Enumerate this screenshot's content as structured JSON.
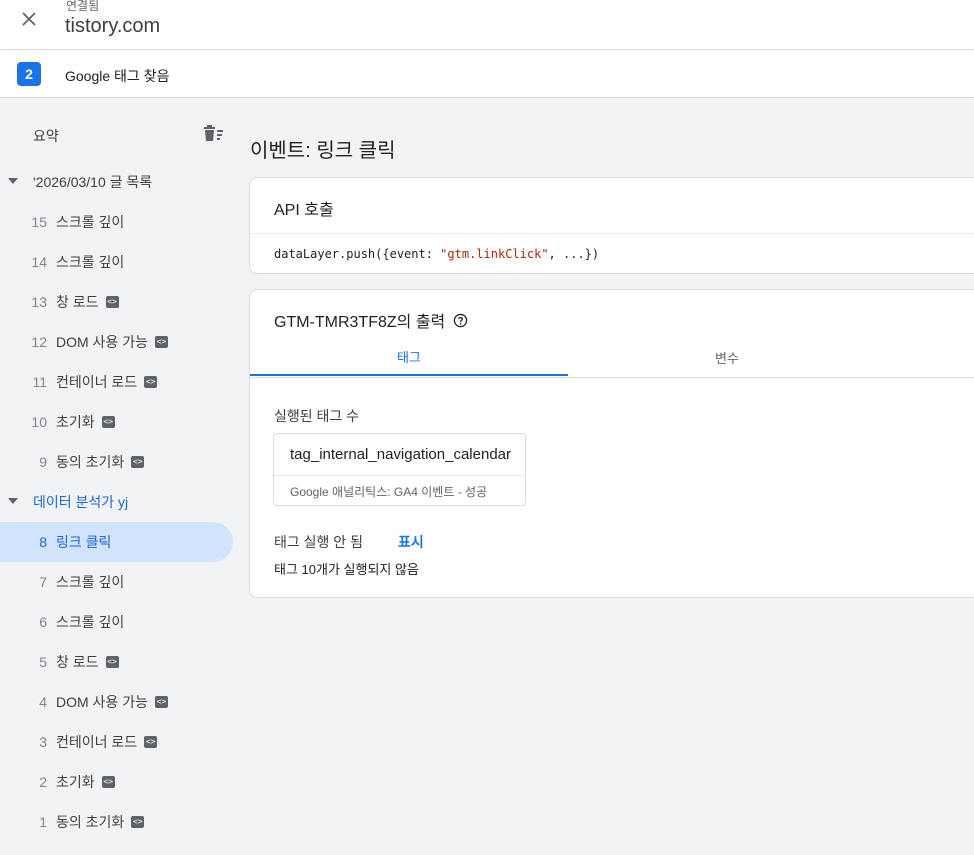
{
  "header": {
    "connection_status": "연결됨",
    "domain": "tistory.com"
  },
  "tag_bar": {
    "count": "2",
    "label": "Google 태그 찾음"
  },
  "sidebar": {
    "summary_label": "요약",
    "groups": [
      {
        "label": "'2026/03/10 글 목록",
        "color": "#3c4043",
        "events": [
          {
            "num": "15",
            "label": "스크롤 깊이"
          },
          {
            "num": "14",
            "label": "스크롤 깊이"
          },
          {
            "num": "13",
            "label": "창 로드"
          },
          {
            "num": "12",
            "label": "DOM 사용 가능"
          },
          {
            "num": "11",
            "label": "컨테이너 로드"
          },
          {
            "num": "10",
            "label": "초기화"
          },
          {
            "num": "9",
            "label": "동의 초기화"
          }
        ]
      },
      {
        "label": "데이터 분석가 yj",
        "color": "#1967d2",
        "events": [
          {
            "num": "8",
            "label": "링크 클릭"
          },
          {
            "num": "7",
            "label": "스크롤 깊이"
          },
          {
            "num": "6",
            "label": "스크롤 깊이"
          },
          {
            "num": "5",
            "label": "창 로드"
          },
          {
            "num": "4",
            "label": "DOM 사용 가능"
          },
          {
            "num": "3",
            "label": "컨테이너 로드"
          },
          {
            "num": "2",
            "label": "초기화"
          },
          {
            "num": "1",
            "label": "동의 초기화"
          }
        ]
      }
    ],
    "code_badge_glyph": "<>"
  },
  "main": {
    "event_title": "이벤트: 링크 클릭",
    "api_card": {
      "title": "API 호출",
      "code_prefix": "dataLayer.push({event: ",
      "code_string": "\"gtm.linkClick\"",
      "code_suffix": ", ...})"
    },
    "output_card": {
      "title": "GTM-TMR3TF8Z의 출력",
      "tabs": [
        {
          "label": "태그"
        },
        {
          "label": "변수"
        }
      ],
      "fired_label": "실행된 태그 수",
      "fired_tag": {
        "name": "tag_internal_navigation_calendar",
        "status": "Google 애널리틱스: GA4 이벤트 - 성공"
      },
      "not_fired_label": "태그 실행 안 됨",
      "show_link": "표시",
      "not_fired_count": "태그 10개가 실행되지 않음"
    }
  },
  "colors": {
    "accent": "#1a73e8",
    "selected_bg": "#d2e3fc",
    "sidebar_bg": "#f1f3f4"
  }
}
